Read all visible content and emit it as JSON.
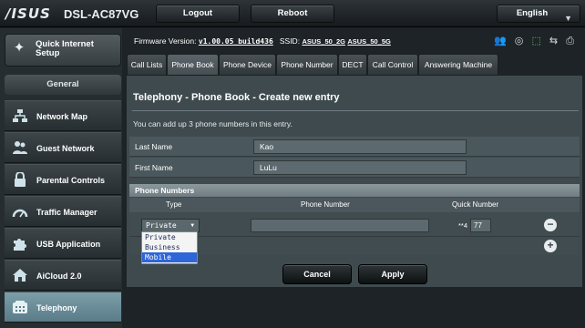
{
  "header": {
    "logo": "/ISUS",
    "model": "DSL-AC87VG",
    "logout_label": "Logout",
    "reboot_label": "Reboot",
    "language": "English",
    "language_caret": "▼"
  },
  "status": {
    "firmware_label": "Firmware Version:",
    "firmware_value": "v1.00.05_build436",
    "ssid_label": "SSID:",
    "ssid_1": "ASUS_50_2G",
    "ssid_2": "ASUS_50_5G",
    "icons": [
      "users-icon",
      "globe-icon",
      "usb-icon",
      "printer-icon"
    ]
  },
  "sidebar": {
    "qis_label": "Quick Internet Setup",
    "section_label": "General",
    "items": [
      {
        "label": "Network Map",
        "icon": "network-map-icon"
      },
      {
        "label": "Guest Network",
        "icon": "guest-network-icon"
      },
      {
        "label": "Parental Controls",
        "icon": "lock-icon"
      },
      {
        "label": "Traffic Manager",
        "icon": "gauge-icon"
      },
      {
        "label": "USB Application",
        "icon": "puzzle-icon"
      },
      {
        "label": "AiCloud 2.0",
        "icon": "cloud-home-icon"
      },
      {
        "label": "Telephony",
        "icon": "telephone-icon",
        "active": true
      }
    ]
  },
  "tabs": [
    {
      "label": "Call Lists"
    },
    {
      "label": "Phone Book",
      "active": true
    },
    {
      "label": "Phone Device"
    },
    {
      "label": "Phone Number"
    },
    {
      "label": "DECT"
    },
    {
      "label": "Call Control"
    },
    {
      "label": "Answering Machine"
    }
  ],
  "panel": {
    "title": "Telephony - Phone Book - Create new entry",
    "description": "You can add up 3 phone numbers in this entry.",
    "last_name_label": "Last Name",
    "last_name_value": "Kao",
    "first_name_label": "First Name",
    "first_name_value": "LuLu",
    "phone_numbers_header": "Phone Numbers",
    "columns": {
      "type": "Type",
      "phone_number": "Phone Number",
      "quick_number": "Quick Number"
    },
    "row": {
      "type_value": "Private",
      "quick_prefix": "**4",
      "quick_value": "77"
    },
    "type_options": [
      "Private",
      "Business",
      "Mobile"
    ],
    "highlighted_option": "Mobile",
    "cancel_label": "Cancel",
    "apply_label": "Apply"
  }
}
